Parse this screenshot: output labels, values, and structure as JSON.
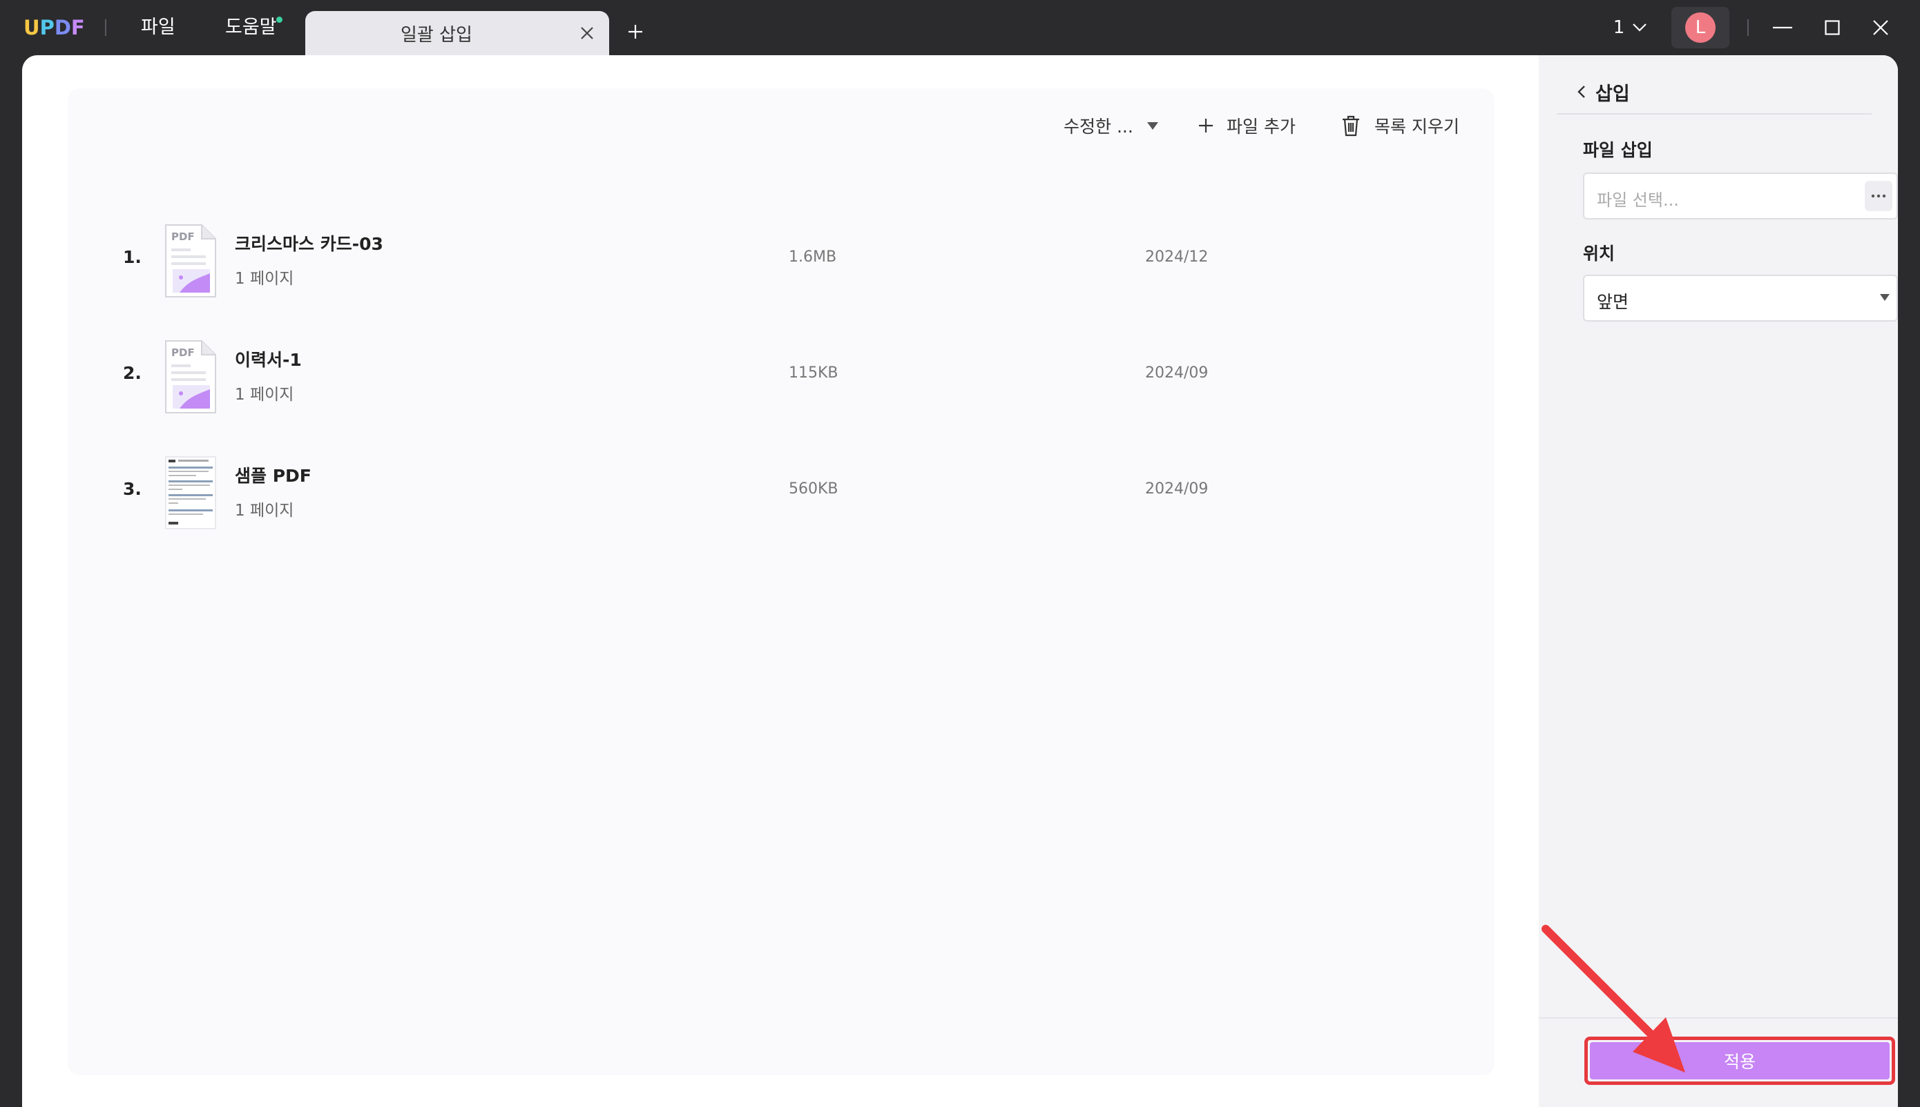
{
  "app": {
    "logo_letters": [
      "U",
      "P",
      "D",
      "F"
    ],
    "logo_colors": [
      "#f6c744",
      "#52c7ea",
      "#7b8cf2",
      "#c58af9"
    ]
  },
  "menu": {
    "file": "파일",
    "help": "도움말",
    "help_badge_color": "#3ad29f"
  },
  "tabs": [
    {
      "label": "일괄 삽입",
      "active": true
    }
  ],
  "titlebar": {
    "page_count": "1",
    "avatar_letter": "L",
    "avatar_color": "#f07a84"
  },
  "toolbar": {
    "sort_label": "수정한 ...",
    "add_file_label": "파일 추가",
    "clear_list_label": "목록 지우기"
  },
  "files": [
    {
      "index": "1.",
      "name": "크리스마스 카드-03",
      "pages": "1 페이지",
      "size": "1.6MB",
      "date": "2024/12",
      "thumb": "pdf-icon"
    },
    {
      "index": "2.",
      "name": "이력서-1",
      "pages": "1 페이지",
      "size": "115KB",
      "date": "2024/09",
      "thumb": "pdf-icon"
    },
    {
      "index": "3.",
      "name": "샘플 PDF",
      "pages": "1 페이지",
      "size": "560KB",
      "date": "2024/09",
      "thumb": "document-preview"
    }
  ],
  "panel": {
    "title": "삽입",
    "insert_file_label": "파일 삽입",
    "file_placeholder": "파일 선택...",
    "position_label": "위치",
    "position_value": "앞면",
    "apply_label": "적용",
    "apply_color": "#c785f5",
    "highlight_color": "#e5393f"
  }
}
